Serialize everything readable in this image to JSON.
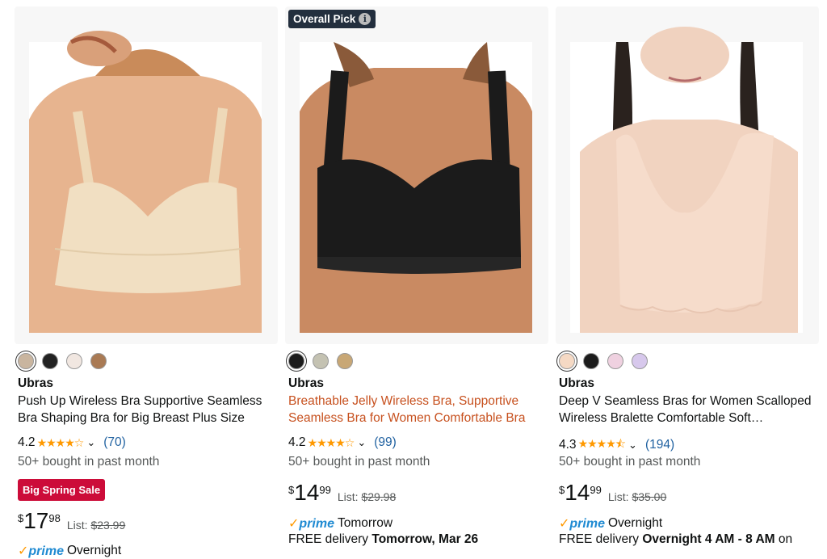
{
  "products": [
    {
      "brand": "Ubras",
      "title_line1": "Push Up Wireless Bra Supportive Seamless",
      "title_line2": "Bra Shaping Bra for Big Breast Plus Size",
      "rating": "4.2",
      "stars": "★★★★☆",
      "review_count": "(70)",
      "bought": "50+ bought in past month",
      "sale_badge": "Big Spring Sale",
      "price_symbol": "$",
      "price_whole": "17",
      "price_fraction": "98",
      "list_label": "List:",
      "list_price": "$23.99",
      "prime_text": "Overnight",
      "swatches": [
        "#c9b59f",
        "#222222",
        "#f1e7e1",
        "#a97a54"
      ]
    },
    {
      "badge": "Overall Pick",
      "brand": "Ubras",
      "title_line1": "Breathable Jelly Wireless Bra, Supportive",
      "title_line2": "Seamless Bra for Women Comfortable Bra",
      "rating": "4.2",
      "stars": "★★★★☆",
      "review_count": "(99)",
      "bought": "50+ bought in past month",
      "price_symbol": "$",
      "price_whole": "14",
      "price_fraction": "99",
      "list_label": "List:",
      "list_price": "$29.98",
      "prime_logo": "prime",
      "prime_text": "Tomorrow",
      "delivery_prefix": "FREE delivery ",
      "delivery_date": "Tomorrow, Mar 26",
      "swatches": [
        "#1c1c1c",
        "#c4c2b2",
        "#c8a775"
      ]
    },
    {
      "brand": "Ubras",
      "title_line1": "Deep V Seamless Bras for Women Scalloped",
      "title_line2": "Wireless Bralette Comfortable Soft…",
      "rating": "4.3",
      "stars": "★★★★⯪",
      "review_count": "(194)",
      "bought": "50+ bought in past month",
      "price_symbol": "$",
      "price_whole": "14",
      "price_fraction": "99",
      "list_label": "List:",
      "list_price": "$35.00",
      "prime_logo": "prime",
      "prime_text": "Overnight",
      "delivery_prefix": "FREE delivery ",
      "delivery_date": "Overnight 4 AM - 8 AM",
      "delivery_suffix": " on",
      "swatches": [
        "#f5d9c4",
        "#1c1c1c",
        "#efd1e0",
        "#d7c8ec"
      ]
    }
  ],
  "colors": {
    "link": "#2162a1",
    "star": "#ff9900",
    "sale": "#cc0c39",
    "prime": "#1f8ad2",
    "badge": "#232f3e"
  }
}
